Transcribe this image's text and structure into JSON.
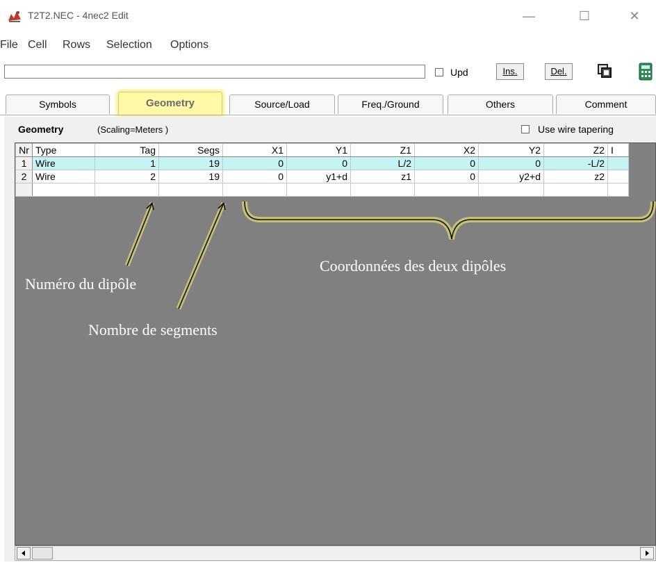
{
  "window": {
    "title": "T2T2.NEC - 4nec2 Edit",
    "minimize_glyph": "—",
    "maximize_glyph": "☐",
    "close_glyph": "✕"
  },
  "menu": [
    "File",
    "Cell",
    "Rows",
    "Selection",
    "Options"
  ],
  "toolbar": {
    "cell_value": "",
    "upd_label": "Upd",
    "ins_label": "Ins.",
    "del_label": "Del.",
    "copy_icon": "copy-icon",
    "calculator_icon": "calculator-icon"
  },
  "tabs": [
    {
      "label": "Symbols",
      "active": false
    },
    {
      "label": "Geometry",
      "active": true
    },
    {
      "label": "Source/Load",
      "active": false
    },
    {
      "label": "Freq./Ground",
      "active": false
    },
    {
      "label": "Others",
      "active": false
    },
    {
      "label": "Comment",
      "active": false
    }
  ],
  "panel": {
    "title": "Geometry",
    "scaling": "(Scaling=Meters )",
    "taper_label": "Use wire tapering"
  },
  "grid": {
    "columns": [
      "Nr",
      "Type",
      "Tag",
      "Segs",
      "X1",
      "Y1",
      "Z1",
      "X2",
      "Y2",
      "Z2",
      "I"
    ],
    "rows": [
      [
        "1",
        "Wire",
        "1",
        "19",
        "0",
        "0",
        "L/2",
        "0",
        "0",
        "-L/2",
        ""
      ],
      [
        "2",
        "Wire",
        "2",
        "19",
        "0",
        "y1+d",
        "z1",
        "0",
        "y2+d",
        "z2",
        ""
      ],
      [
        "",
        "",
        "",
        "",
        "",
        "",
        "",
        "",
        "",
        "",
        ""
      ]
    ],
    "selected_row": 0
  },
  "annotations": {
    "numero": "Numéro du dipôle",
    "segments": "Nombre de segments",
    "coords": "Coordonnées des deux dipôles"
  },
  "colors": {
    "active_tab": "#fff9a8",
    "selected_row": "#c6f4f4",
    "grid_background": "#808080",
    "annotation_highlight": "#f4ee70"
  }
}
